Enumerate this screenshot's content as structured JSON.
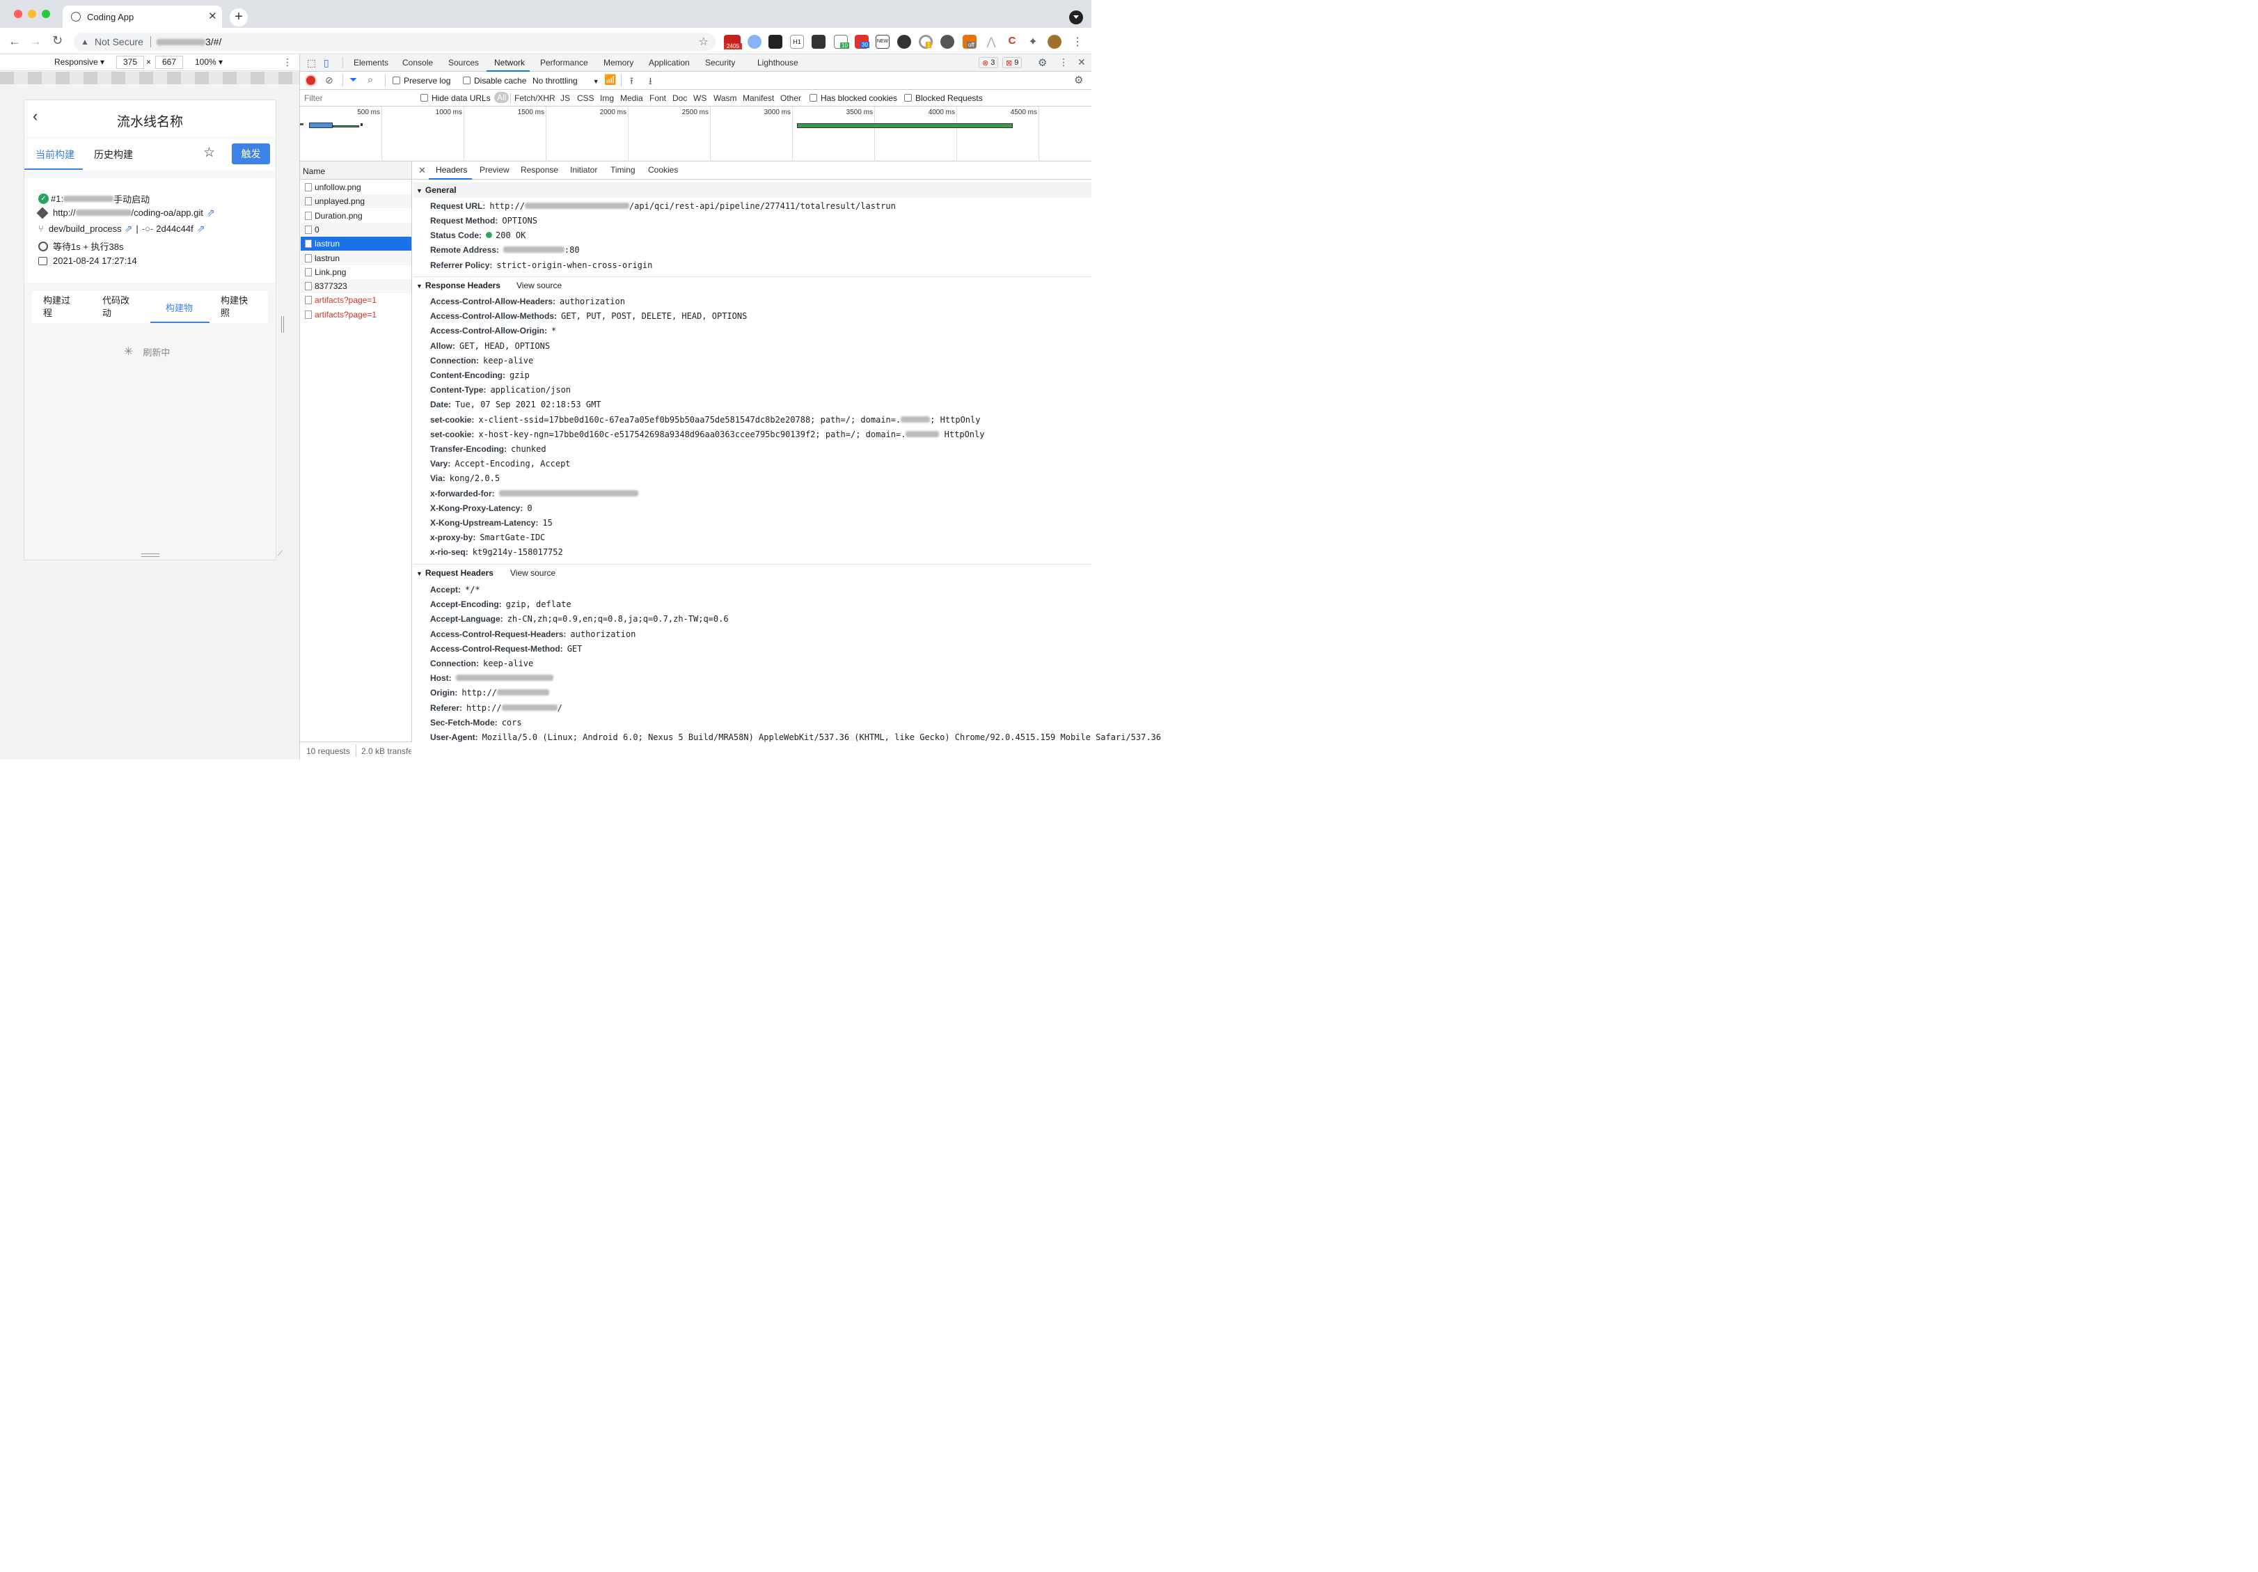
{
  "browser": {
    "tab_title": "Coding App",
    "address": {
      "security": "Not Secure",
      "url_tail": "3/#/"
    },
    "extension_badges": {
      "gmail": "2405",
      "ext_green": "10",
      "ext_blue": "30",
      "ext_new": "NEW",
      "ext_orange": "1",
      "ext_off": "off"
    }
  },
  "device_toolbar": {
    "mode": "Responsive",
    "width": "375",
    "times": "×",
    "height": "667",
    "zoom": "100%"
  },
  "app": {
    "title": "流水线名称",
    "tabs": [
      "当前构建",
      "历史构建"
    ],
    "trigger_label": "触发",
    "build": {
      "id_prefix": "#1:",
      "trigger_text": "手动启动",
      "repo_prefix": "http://",
      "repo_suffix": "/coding-oa/app.git",
      "branch": "dev/build_process",
      "divider": "|",
      "commit": "2d44c44f",
      "timing": "等待1s + 执行38s",
      "date": "2021-08-24 17:27:14"
    },
    "sub_tabs": [
      {
        "label": "构建过程",
        "line1": "构建过",
        "line2": "程"
      },
      {
        "label": "代码改动",
        "line1": "代码改",
        "line2": "动"
      },
      {
        "label": "构建物",
        "line1": "构建物",
        "line2": ""
      },
      {
        "label": "构建快照",
        "line1": "构建快",
        "line2": "照"
      }
    ],
    "loading_text": "刷新中"
  },
  "devtools": {
    "tabs": [
      "Elements",
      "Console",
      "Sources",
      "Network",
      "Performance",
      "Memory",
      "Application",
      "Security",
      "Lighthouse"
    ],
    "active_tab": "Network",
    "error_count": "3",
    "warning_count": "9",
    "network_toolbar": {
      "preserve_log": "Preserve log",
      "disable_cache": "Disable cache",
      "throttling": "No throttling"
    },
    "filter": {
      "placeholder": "Filter",
      "hide_data_urls": "Hide data URLs",
      "types": [
        "All",
        "Fetch/XHR",
        "JS",
        "CSS",
        "Img",
        "Media",
        "Font",
        "Doc",
        "WS",
        "Wasm",
        "Manifest",
        "Other"
      ],
      "has_blocked_cookies": "Has blocked cookies",
      "blocked_requests": "Blocked Requests"
    },
    "timeline_ticks": [
      "500 ms",
      "1000 ms",
      "1500 ms",
      "2000 ms",
      "2500 ms",
      "3000 ms",
      "3500 ms",
      "4000 ms",
      "4500 ms"
    ],
    "requests_header": "Name",
    "requests": [
      {
        "name": "unfollow.png",
        "error": false,
        "selected": false
      },
      {
        "name": "unplayed.png",
        "error": false,
        "selected": false
      },
      {
        "name": "Duration.png",
        "error": false,
        "selected": false
      },
      {
        "name": "0",
        "error": false,
        "selected": false
      },
      {
        "name": "lastrun",
        "error": false,
        "selected": true
      },
      {
        "name": "lastrun",
        "error": false,
        "selected": false
      },
      {
        "name": "Link.png",
        "error": false,
        "selected": false
      },
      {
        "name": "8377323",
        "error": false,
        "selected": false
      },
      {
        "name": "artifacts?page=1",
        "error": true,
        "selected": false
      },
      {
        "name": "artifacts?page=1",
        "error": true,
        "selected": false
      }
    ],
    "summary": {
      "requests": "10 requests",
      "transferred": "2.0 kB transfe"
    },
    "detail_tabs": [
      "Headers",
      "Preview",
      "Response",
      "Initiator",
      "Timing",
      "Cookies"
    ],
    "general": {
      "title": "General",
      "rows": [
        {
          "k": "Request URL:",
          "v_prefix": "http://",
          "v": "/api/qci/rest-api/pipeline/277411/totalresult/lastrun"
        },
        {
          "k": "Request Method:",
          "v_prefix": "",
          "v": "OPTIONS"
        },
        {
          "k": "Status Code:",
          "v_prefix": "",
          "v": "200 OK"
        },
        {
          "k": "Remote Address:",
          "v_prefix": "",
          "v": ":80"
        },
        {
          "k": "Referrer Policy:",
          "v_prefix": "",
          "v": "strict-origin-when-cross-origin"
        }
      ]
    },
    "response_headers": {
      "title": "Response Headers",
      "view_source": "View source",
      "rows": [
        {
          "k": "Access-Control-Allow-Headers:",
          "v": "authorization"
        },
        {
          "k": "Access-Control-Allow-Methods:",
          "v": "GET, PUT, POST, DELETE, HEAD, OPTIONS"
        },
        {
          "k": "Access-Control-Allow-Origin:",
          "v": "*"
        },
        {
          "k": "Allow:",
          "v": "GET, HEAD, OPTIONS"
        },
        {
          "k": "Connection:",
          "v": "keep-alive"
        },
        {
          "k": "Content-Encoding:",
          "v": "gzip"
        },
        {
          "k": "Content-Type:",
          "v": "application/json"
        },
        {
          "k": "Date:",
          "v": "Tue, 07 Sep 2021 02:18:53 GMT"
        },
        {
          "k": "set-cookie:",
          "v": "x-client-ssid=17bbe0d160c-67ea7a05ef0b95b50aa75de581547dc8b2e20788; path=/; domain=.",
          "v_tail": "; HttpOnly"
        },
        {
          "k": "set-cookie:",
          "v": "x-host-key-ngn=17bbe0d160c-e517542698a9348d96aa0363ccee795bc90139f2; path=/; domain=.",
          "v_tail": " HttpOnly"
        },
        {
          "k": "Transfer-Encoding:",
          "v": "chunked"
        },
        {
          "k": "Vary:",
          "v": "Accept-Encoding, Accept"
        },
        {
          "k": "Via:",
          "v": "kong/2.0.5"
        },
        {
          "k": "x-forwarded-for:",
          "v": ""
        },
        {
          "k": "X-Kong-Proxy-Latency:",
          "v": "0"
        },
        {
          "k": "X-Kong-Upstream-Latency:",
          "v": "15"
        },
        {
          "k": "x-proxy-by:",
          "v": "SmartGate-IDC"
        },
        {
          "k": "x-rio-seq:",
          "v": "kt9g214y-158017752"
        }
      ]
    },
    "request_headers": {
      "title": "Request Headers",
      "view_source": "View source",
      "rows": [
        {
          "k": "Accept:",
          "v": "*/*"
        },
        {
          "k": "Accept-Encoding:",
          "v": "gzip, deflate"
        },
        {
          "k": "Accept-Language:",
          "v": "zh-CN,zh;q=0.9,en;q=0.8,ja;q=0.7,zh-TW;q=0.6"
        },
        {
          "k": "Access-Control-Request-Headers:",
          "v": "authorization"
        },
        {
          "k": "Access-Control-Request-Method:",
          "v": "GET"
        },
        {
          "k": "Connection:",
          "v": "keep-alive"
        },
        {
          "k": "Host:",
          "v": ""
        },
        {
          "k": "Origin:",
          "v": "http://"
        },
        {
          "k": "Referer:",
          "v": "http://",
          "v_tail": "/"
        },
        {
          "k": "Sec-Fetch-Mode:",
          "v": "cors"
        },
        {
          "k": "User-Agent:",
          "v": "Mozilla/5.0 (Linux; Android 6.0; Nexus 5 Build/MRA58N) AppleWebKit/537.36 (KHTML, like Gecko) Chrome/92.0.4515.159 Mobile Safari/537.36"
        }
      ]
    }
  }
}
